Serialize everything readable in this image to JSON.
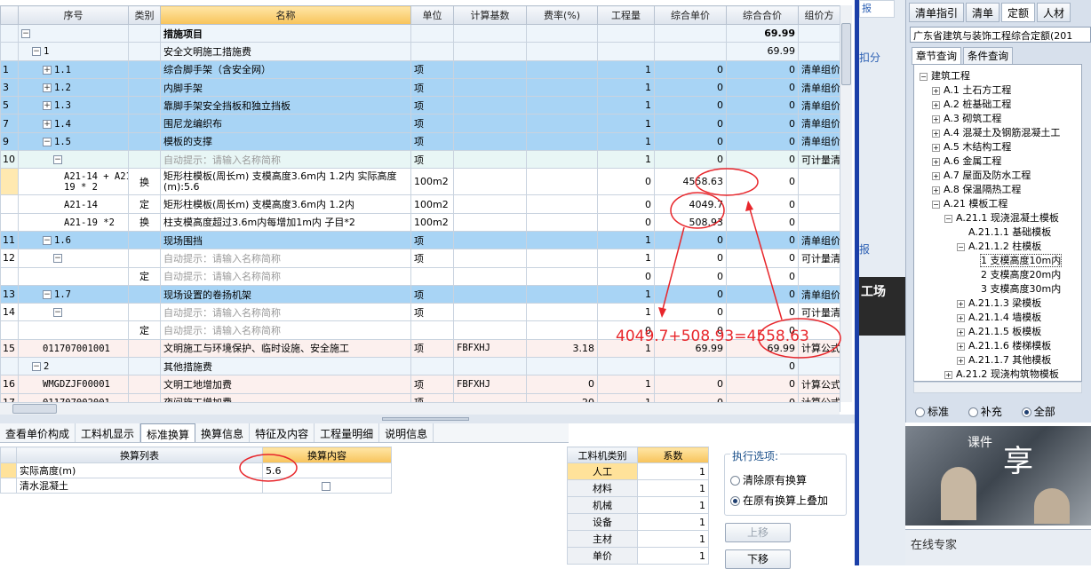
{
  "grid": {
    "headers": [
      "序号",
      "类别",
      "名称",
      "单位",
      "计算基数",
      "费率(%)",
      "工程量",
      "综合单价",
      "综合合价",
      "组价方"
    ],
    "rows": [
      {
        "no": "",
        "code": "",
        "cat": "",
        "name": "措施项目",
        "unit": "",
        "base": "",
        "rate": "",
        "qty": "",
        "price": "",
        "total": "69.99",
        "extra": ""
      },
      {
        "no": "",
        "code": "1",
        "cat": "",
        "name": "安全文明施工措施费",
        "unit": "",
        "base": "",
        "rate": "",
        "qty": "",
        "price": "",
        "total": "69.99",
        "extra": ""
      },
      {
        "no": "1",
        "code": "1.1",
        "cat": "",
        "name": "综合脚手架（含安全网）",
        "unit": "项",
        "base": "",
        "rate": "",
        "qty": "1",
        "price": "0",
        "total": "0",
        "extra": "清单组价"
      },
      {
        "no": "3",
        "code": "1.2",
        "cat": "",
        "name": "内脚手架",
        "unit": "项",
        "base": "",
        "rate": "",
        "qty": "1",
        "price": "0",
        "total": "0",
        "extra": "清单组价"
      },
      {
        "no": "5",
        "code": "1.3",
        "cat": "",
        "name": "靠脚手架安全挡板和独立挡板",
        "unit": "项",
        "base": "",
        "rate": "",
        "qty": "1",
        "price": "0",
        "total": "0",
        "extra": "清单组价"
      },
      {
        "no": "7",
        "code": "1.4",
        "cat": "",
        "name": "围尼龙编织布",
        "unit": "项",
        "base": "",
        "rate": "",
        "qty": "1",
        "price": "0",
        "total": "0",
        "extra": "清单组价"
      },
      {
        "no": "9",
        "code": "1.5",
        "cat": "",
        "name": "模板的支撑",
        "unit": "项",
        "base": "",
        "rate": "",
        "qty": "1",
        "price": "0",
        "total": "0",
        "extra": "清单组价"
      },
      {
        "no": "10",
        "code": "",
        "cat": "",
        "name": "自动提示：请输入名称简称",
        "unit": "项",
        "base": "",
        "rate": "",
        "qty": "1",
        "price": "0",
        "total": "0",
        "extra": "可计量清"
      },
      {
        "no": "",
        "code": "A21-14 + A21-19 * 2",
        "cat": "换",
        "name": "矩形柱模板(周长m) 支模高度3.6m内 1.2内 实际高度(m):5.6",
        "unit": "100m2",
        "base": "",
        "rate": "",
        "qty": "0",
        "price": "4558.63",
        "total": "0",
        "extra": ""
      },
      {
        "no": "",
        "code": "A21-14",
        "cat": "定",
        "name": "矩形柱模板(周长m) 支模高度3.6m内 1.2内",
        "unit": "100m2",
        "base": "",
        "rate": "",
        "qty": "0",
        "price": "4049.7",
        "total": "0",
        "extra": ""
      },
      {
        "no": "",
        "code": "A21-19 *2",
        "cat": "换",
        "name": "柱支模高度超过3.6m内每增加1m内 子目*2",
        "unit": "100m2",
        "base": "",
        "rate": "",
        "qty": "0",
        "price": "508.93",
        "total": "0",
        "extra": ""
      },
      {
        "no": "11",
        "code": "1.6",
        "cat": "",
        "name": "现场围挡",
        "unit": "项",
        "base": "",
        "rate": "",
        "qty": "1",
        "price": "0",
        "total": "0",
        "extra": "清单组价"
      },
      {
        "no": "12",
        "code": "",
        "cat": "",
        "name": "自动提示：请输入名称简称",
        "unit": "项",
        "base": "",
        "rate": "",
        "qty": "1",
        "price": "0",
        "total": "0",
        "extra": "可计量清"
      },
      {
        "no": "",
        "code": "",
        "cat": "定",
        "name": "自动提示：请输入名称简称",
        "unit": "",
        "base": "",
        "rate": "",
        "qty": "0",
        "price": "0",
        "total": "0",
        "extra": ""
      },
      {
        "no": "13",
        "code": "1.7",
        "cat": "",
        "name": "现场设置的卷扬机架",
        "unit": "项",
        "base": "",
        "rate": "",
        "qty": "1",
        "price": "0",
        "total": "0",
        "extra": "清单组价"
      },
      {
        "no": "14",
        "code": "",
        "cat": "",
        "name": "自动提示：请输入名称简称",
        "unit": "项",
        "base": "",
        "rate": "",
        "qty": "1",
        "price": "0",
        "total": "0",
        "extra": "可计量清"
      },
      {
        "no": "",
        "code": "",
        "cat": "定",
        "name": "自动提示：请输入名称简称",
        "unit": "",
        "base": "",
        "rate": "",
        "qty": "0",
        "price": "0",
        "total": "0",
        "extra": ""
      },
      {
        "no": "15",
        "code": "011707001001",
        "cat": "",
        "name": "文明施工与环境保护、临时设施、安全施工",
        "unit": "项",
        "base": "FBFXHJ",
        "rate": "3.18",
        "qty": "1",
        "price": "69.99",
        "total": "69.99",
        "extra": "计算公式"
      },
      {
        "no": "",
        "code": "2",
        "cat": "",
        "name": "其他措施费",
        "unit": "",
        "base": "",
        "rate": "",
        "qty": "",
        "price": "",
        "total": "0",
        "extra": ""
      },
      {
        "no": "16",
        "code": "WMGDZJF00001",
        "cat": "",
        "name": "文明工地增加费",
        "unit": "项",
        "base": "FBFXHJ",
        "rate": "0",
        "qty": "1",
        "price": "0",
        "total": "0",
        "extra": "计算公式"
      },
      {
        "no": "17",
        "code": "011707002001",
        "cat": "",
        "name": "夜间施工增加费",
        "unit": "项",
        "base": "",
        "rate": "20",
        "qty": "1",
        "price": "0",
        "total": "0",
        "extra": "计算公式"
      }
    ]
  },
  "annotation": "4049.7+508.93=4558.63",
  "bottom_tabs": [
    "查看单价构成",
    "工料机显示",
    "标准换算",
    "换算信息",
    "特征及内容",
    "工程量明细",
    "说明信息"
  ],
  "calc": {
    "headers": [
      "换算列表",
      "换算内容"
    ],
    "rows": [
      {
        "label": "实际高度(m)",
        "value": "5.6"
      },
      {
        "label": "清水混凝土",
        "value": ""
      }
    ]
  },
  "coef": {
    "headers": [
      "工料机类别",
      "系数"
    ],
    "rows": [
      {
        "label": "人工",
        "value": "1"
      },
      {
        "label": "材料",
        "value": "1"
      },
      {
        "label": "机械",
        "value": "1"
      },
      {
        "label": "设备",
        "value": "1"
      },
      {
        "label": "主材",
        "value": "1"
      },
      {
        "label": "单价",
        "value": "1"
      }
    ]
  },
  "options": {
    "title": "执行选项:",
    "opt1": "清除原有换算",
    "opt2": "在原有换算上叠加",
    "up": "上移",
    "down": "下移"
  },
  "midstrip": {
    "t1": "报",
    "t2": "扣分",
    "t3": "报",
    "t4": "工场"
  },
  "lib": {
    "tabs": [
      "清单指引",
      "清单",
      "定额",
      "人材"
    ],
    "select": "广东省建筑与装饰工程综合定额(201",
    "subtabs": [
      "章节查询",
      "条件查询"
    ],
    "tree": [
      "建筑工程",
      "A.1 土石方工程",
      "A.2 桩基础工程",
      "A.3 砌筑工程",
      "A.4 混凝土及钢筋混凝土工",
      "A.5 木结构工程",
      "A.6 金属工程",
      "A.7 屋面及防水工程",
      "A.8 保温隔热工程",
      "A.21 模板工程",
      "A.21.1 现浇混凝土模板",
      "A.21.1.1 基础模板",
      "A.21.1.2 柱模板",
      "1 支模高度10m内",
      "2 支模高度20m内",
      "3 支模高度30m内",
      "A.21.1.3 梁模板",
      "A.21.1.4 墙模板",
      "A.21.1.5 板模板",
      "A.21.1.6 楼梯模板",
      "A.21.1.7 其他模板",
      "A.21.2 现浇构筑物模板"
    ],
    "radios": [
      "标准",
      "补充",
      "全部"
    ]
  },
  "photo_text": {
    "a": "课件",
    "b": "享"
  },
  "expert": "在线专家"
}
